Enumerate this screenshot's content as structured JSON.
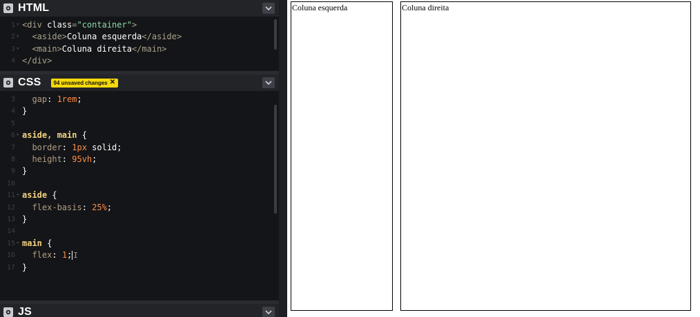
{
  "editor": {
    "html_panel": {
      "title": "HTML",
      "icon": "gear-icon",
      "collapse_icon": "chevron-down-icon",
      "lines": [
        {
          "n": "1",
          "fold": "▾",
          "parts": [
            [
              "tg",
              "<div "
            ],
            [
              "at",
              "class"
            ],
            [
              "tg",
              "="
            ],
            [
              "st",
              "\"container\""
            ],
            [
              "tg",
              ">"
            ]
          ]
        },
        {
          "n": "2",
          "fold": "▾",
          "parts": [
            [
              "tg",
              "  <aside>"
            ],
            [
              "kw",
              "Coluna esquerda"
            ],
            [
              "tg",
              "</aside>"
            ]
          ]
        },
        {
          "n": "3",
          "fold": "▾",
          "parts": [
            [
              "tg",
              "  <main>"
            ],
            [
              "kw",
              "Coluna direita"
            ],
            [
              "tg",
              "</main>"
            ]
          ]
        },
        {
          "n": "4",
          "fold": "",
          "parts": [
            [
              "tg",
              "</div>"
            ]
          ]
        }
      ]
    },
    "css_panel": {
      "title": "CSS",
      "badge": "94 unsaved changes",
      "badge_close": "✕",
      "icon": "gear-icon",
      "collapse_icon": "chevron-down-icon",
      "lines": [
        {
          "n": "3",
          "fold": "",
          "parts": [
            [
              "pr",
              "  gap"
            ],
            [
              "kw",
              ": "
            ],
            [
              "nu",
              "1rem"
            ],
            [
              "kw",
              ";"
            ]
          ]
        },
        {
          "n": "4",
          "fold": "",
          "parts": [
            [
              "kw",
              "}"
            ]
          ]
        },
        {
          "n": "5",
          "fold": "",
          "parts": []
        },
        {
          "n": "6",
          "fold": "▾",
          "parts": [
            [
              "sel",
              "aside, main"
            ],
            [
              "kw",
              " {"
            ]
          ]
        },
        {
          "n": "7",
          "fold": "",
          "parts": [
            [
              "pr",
              "  border"
            ],
            [
              "kw",
              ": "
            ],
            [
              "nu",
              "1px"
            ],
            [
              "kw",
              " solid;"
            ]
          ]
        },
        {
          "n": "8",
          "fold": "",
          "parts": [
            [
              "pr",
              "  height"
            ],
            [
              "kw",
              ": "
            ],
            [
              "nu",
              "95vh"
            ],
            [
              "kw",
              ";"
            ]
          ]
        },
        {
          "n": "9",
          "fold": "",
          "parts": [
            [
              "kw",
              "}"
            ]
          ]
        },
        {
          "n": "10",
          "fold": "",
          "parts": []
        },
        {
          "n": "11",
          "fold": "▾",
          "parts": [
            [
              "sel",
              "aside"
            ],
            [
              "kw",
              " {"
            ]
          ]
        },
        {
          "n": "12",
          "fold": "",
          "parts": [
            [
              "pr",
              "  flex-basis"
            ],
            [
              "kw",
              ": "
            ],
            [
              "nu",
              "25%"
            ],
            [
              "kw",
              ";"
            ]
          ]
        },
        {
          "n": "13",
          "fold": "",
          "parts": [
            [
              "kw",
              "}"
            ]
          ]
        },
        {
          "n": "14",
          "fold": "",
          "parts": []
        },
        {
          "n": "15",
          "fold": "▾",
          "parts": [
            [
              "sel",
              "main"
            ],
            [
              "kw",
              " {"
            ]
          ]
        },
        {
          "n": "16",
          "fold": "",
          "parts": [
            [
              "pr",
              "  flex"
            ],
            [
              "kw",
              ": "
            ],
            [
              "nu",
              "1"
            ],
            [
              "kw",
              ";"
            ]
          ],
          "cursor": true
        },
        {
          "n": "17",
          "fold": "",
          "parts": [
            [
              "kw",
              "}"
            ]
          ]
        }
      ]
    },
    "js_panel": {
      "title": "JS",
      "icon": "gear-icon",
      "collapse_icon": "chevron-down-icon"
    }
  },
  "preview": {
    "aside_text": "Coluna esquerda",
    "main_text": "Coluna direita"
  }
}
